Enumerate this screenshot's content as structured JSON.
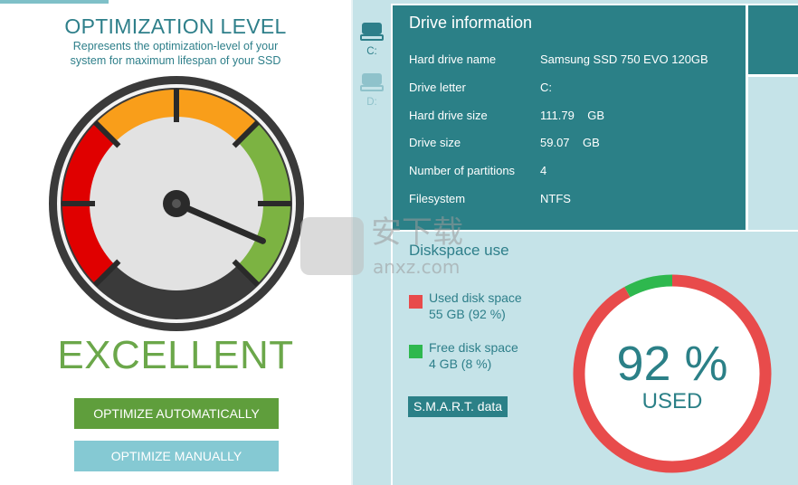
{
  "colors": {
    "teal": "#2b8087",
    "light_teal": "#c5e3e8",
    "green": "#5f9e3c",
    "red": "#e84b4b",
    "orange": "#f99e1a",
    "gauge_green": "#7cb342"
  },
  "optimization": {
    "title": "OPTIMIZATION LEVEL",
    "subtitle_line1": "Represents the optimization-level of your",
    "subtitle_line2": "system for maximum lifespan of your SSD",
    "rating": "EXCELLENT",
    "level_fraction": 0.92,
    "optimize_auto_label": "OPTIMIZE AUTOMATICALLY",
    "optimize_manual_label": "OPTIMIZE MANUALLY"
  },
  "drives": [
    {
      "label": "C:",
      "icon": "hard-drive-icon",
      "selected": true
    },
    {
      "label": "D:",
      "icon": "hard-drive-icon",
      "selected": false
    }
  ],
  "drive_info": {
    "title": "Drive information",
    "rows": [
      {
        "key": "Hard drive name",
        "value": "Samsung SSD 750 EVO 120GB"
      },
      {
        "key": "Drive letter",
        "value": "C:"
      },
      {
        "key": "Hard drive size",
        "value": "111.79    GB"
      },
      {
        "key": "Drive size",
        "value": "59.07    GB"
      },
      {
        "key": "Number of partitions",
        "value": "4"
      },
      {
        "key": "Filesystem",
        "value": "NTFS"
      }
    ]
  },
  "diskspace": {
    "title": "Diskspace use",
    "used_label": "Used disk space",
    "used_value": "55 GB (92 %)",
    "free_label": "Free disk space",
    "free_value": "4 GB (8 %)",
    "smart_label": "S.M.A.R.T. data",
    "percent_text": "92 %",
    "used_text": "USED",
    "used_fraction": 0.92
  },
  "watermark": {
    "text": "安下载",
    "sub": "anxz.com"
  }
}
